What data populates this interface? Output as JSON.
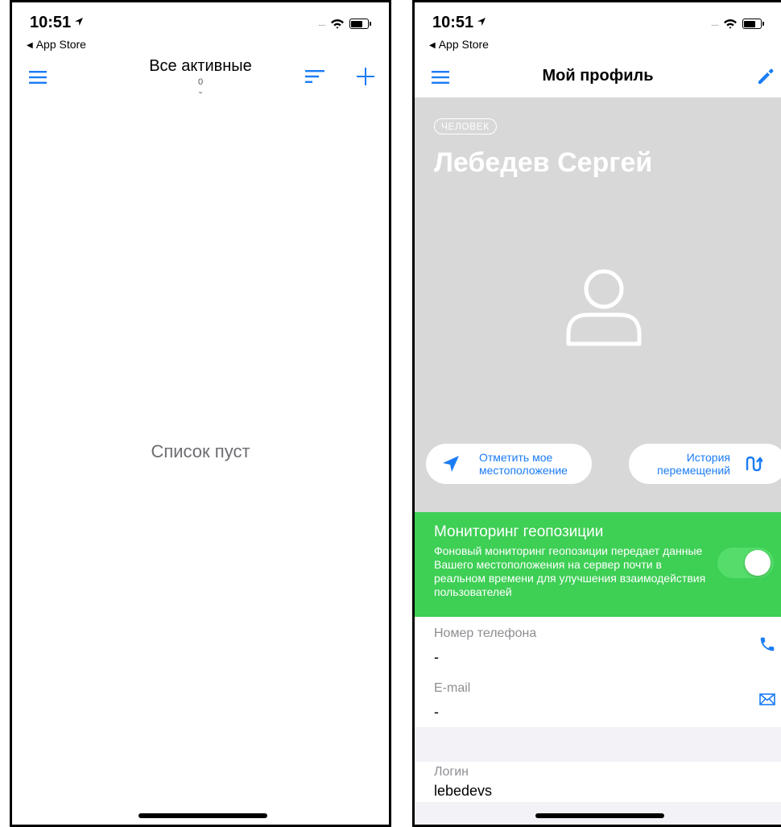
{
  "status": {
    "time": "10:51",
    "back_label": "App Store"
  },
  "left": {
    "title": "Все активные",
    "count": "0",
    "empty_message": "Список пуст"
  },
  "right": {
    "title": "Мой профиль",
    "person_badge": "ЧЕЛОВЕК",
    "name": "Лебедев Сергей",
    "mark_location_label": "Отметить мое местоположение",
    "history_label": "История перемещений",
    "geo": {
      "title": "Мониторинг геопозиции",
      "description": "Фоновый мониторинг геопозиции передает данные Вашего местоположения на сервер почти в реальном времени для улучшения взаимодействия пользователей",
      "enabled": true
    },
    "phone": {
      "label": "Номер телефона",
      "value": "-"
    },
    "email": {
      "label": "E-mail",
      "value": "-"
    },
    "login": {
      "label": "Логин",
      "value": "lebedevs"
    }
  },
  "colors": {
    "accent": "#1b7cf5",
    "geo_panel": "#3ecf55",
    "profile_background": "#d8d8d8"
  },
  "icons": [
    "menu-icon",
    "sort-icon",
    "plus-icon",
    "location-arrow-icon",
    "history-icon",
    "edit-icon",
    "phone-icon",
    "mail-icon",
    "avatar-icon",
    "wifi-icon",
    "battery-icon"
  ]
}
